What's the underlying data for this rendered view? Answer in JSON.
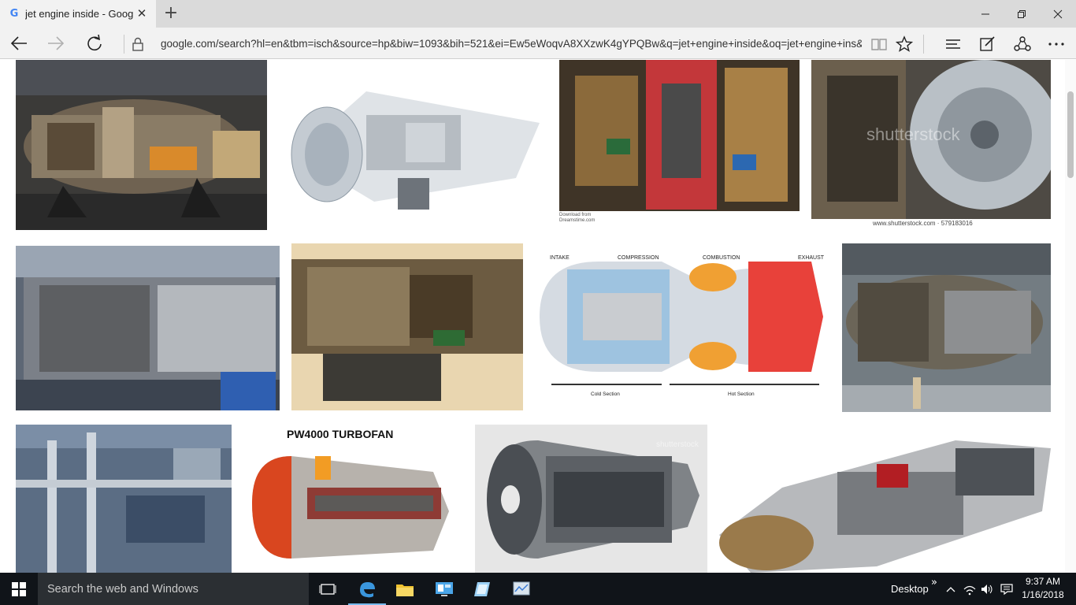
{
  "browser": {
    "tab": {
      "title": "jet engine inside - Goog",
      "favicon": "G"
    },
    "address": {
      "url": "google.com/search?hl=en&tbm=isch&source=hp&biw=1093&bih=521&ei=Ew5eWoqvA8XXzwK4gYPQBw&q=jet+engine+inside&oq=jet+engine+ins&g"
    },
    "icons": [
      "back-icon",
      "forward-icon",
      "refresh-icon",
      "lock-icon",
      "reading-view-icon",
      "favorite-star-icon",
      "hub-icon",
      "web-note-icon",
      "share-icon",
      "more-icon"
    ]
  },
  "results": {
    "captions": {
      "r1c3_src": "Download from Dreamstime.com",
      "r1c4_wm": "shutterstock",
      "r1c4_foot": "www.shutterstock.com · 579183016",
      "r2c3_intake": "INTAKE",
      "r2c3_compression": "COMPRESSION",
      "r2c3_combustion": "COMBUSTION",
      "r2c3_exhaust": "EXHAUST",
      "r2c3_cold": "Cold Section",
      "r2c3_hot": "Hot Section",
      "r3c2_title": "PW4000 TURBOFAN",
      "r3c3_wm": "shutterstock"
    }
  },
  "taskbar": {
    "search_placeholder": "Search the web and Windows",
    "desktop_label": "Desktop",
    "time": "9:37 AM",
    "date": "1/16/2018"
  },
  "colors": {
    "accent": "#76b9ed",
    "taskbar": "#101419",
    "tab_active": "#f2f2f2"
  }
}
